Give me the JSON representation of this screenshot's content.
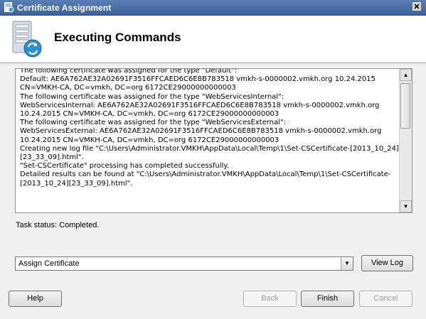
{
  "window": {
    "title": "Certificate Assignment"
  },
  "header": {
    "heading": "Executing Commands"
  },
  "log": {
    "lines": [
      "The following certificate was assigned for the type \"Default\":",
      "Default: AE6A762AE32A02691F3516FFCAED6C6E8B783518 vmkh-s-0000002.vmkh.org 10.24.2015",
      "CN=VMKH-CA, DC=vmkh, DC=org 6172CE29000000000003",
      "The following certificate was assigned for the type \"WebServicesInternal\":",
      "WebServicesInternal: AE6A762AE32A02691F3516FFCAED6C6E8B783518 vmkh-s-0000002.vmkh.org",
      "10.24.2015 CN=VMKH-CA, DC=vmkh, DC=org 6172CE29000000000003",
      "The following certificate was assigned for the type \"WebServicesExternal\":",
      "WebServicesExternal: AE6A762AE32A02691F3516FFCAED6C6E8B783518 vmkh-s-0000002.vmkh.org",
      "10.24.2015 CN=VMKH-CA, DC=vmkh, DC=org 6172CE29000000000003",
      "Creating new log file \"C:\\Users\\Administrator.VMKH\\AppData\\Local\\Temp\\1\\Set-CSCertificate-[2013_10_24]",
      "[23_33_09].html\".",
      "\"Set-CSCertificate\" processing has completed successfully.",
      "Detailed results can be found at \"C:\\Users\\Administrator.VMKH\\AppData\\Local\\Temp\\1\\Set-CSCertificate-",
      "[2013_10_24][23_33_09].html\"."
    ]
  },
  "status": {
    "text": "Task status: Completed."
  },
  "combo": {
    "value": "Assign Certificate"
  },
  "buttons": {
    "view_log": "View Log",
    "help": "Help",
    "back": "Back",
    "finish": "Finish",
    "cancel": "Cancel"
  },
  "icons": {
    "app": "certificate-app-icon",
    "wizard": "server-sync-icon",
    "close": "close-icon",
    "scroll_up": "arrow-up-icon",
    "scroll_down": "arrow-down-icon",
    "dropdown": "chevron-down-icon"
  }
}
